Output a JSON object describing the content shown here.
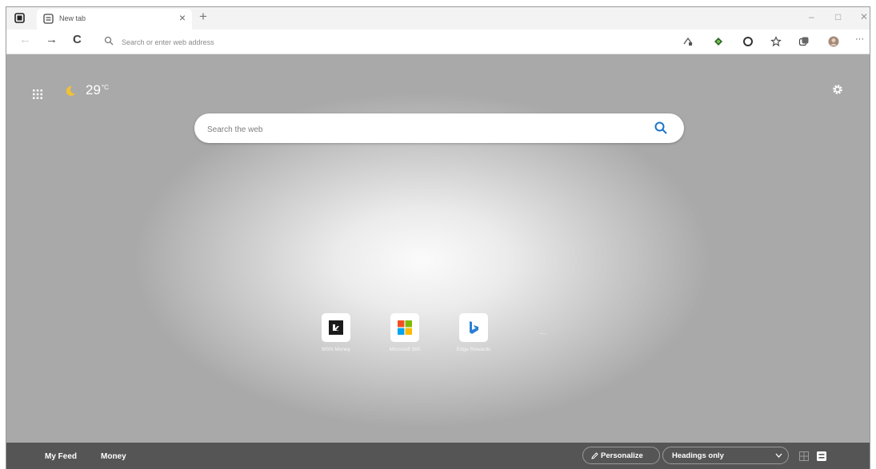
{
  "browser": {
    "tab": {
      "title": "New tab",
      "close": "×"
    },
    "new_tab": "+",
    "window": {
      "minimize": "–",
      "maximize": "□",
      "close": "✕"
    },
    "nav": {
      "back": "←",
      "forward": "→",
      "refresh": "C"
    },
    "address_placeholder": "Search or enter web address",
    "more_menu": "···"
  },
  "ntp": {
    "weather": {
      "temp": "29",
      "unit": "°C"
    },
    "search_placeholder": "Search the web",
    "quick_links": [
      {
        "label": "MSN Money",
        "icon": "msn-money-icon"
      },
      {
        "label": "Microsoft 365",
        "icon": "microsoft-365-icon"
      },
      {
        "label": "Edge Rewards",
        "icon": "bing-icon"
      }
    ],
    "more_links": "···"
  },
  "feed": {
    "tabs": [
      "My Feed",
      "Money"
    ],
    "personalize": "Personalize",
    "content_visibility": "Headings only"
  },
  "colors": {
    "accent_blue": "#1a73c8",
    "feed_bar": "#555555"
  }
}
